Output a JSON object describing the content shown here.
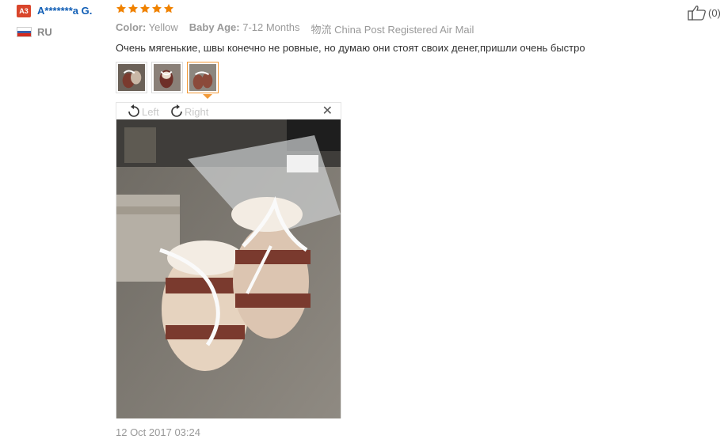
{
  "reviewer": {
    "level_badge": "A3",
    "name": "A*******a G.",
    "country": "RU"
  },
  "rating": {
    "stars": 5,
    "max": 5,
    "color": "#f08200"
  },
  "attributes": [
    {
      "label": "Color:",
      "value": "Yellow"
    },
    {
      "label": "Baby Age:",
      "value": "7-12 Months"
    },
    {
      "label": "物流",
      "value": "China Post Registered Air Mail"
    }
  ],
  "review": {
    "text": "Очень мягенькие, швы конечно не ровные, но думаю они стоят своих денег,пришли очень быстро"
  },
  "photos": {
    "count": 3,
    "active_index": 2
  },
  "viewer": {
    "rotate_left": "Left",
    "rotate_right": "Right",
    "close": "✕"
  },
  "date": "12 Oct 2017 03:24",
  "helpful": {
    "count": "(0)"
  }
}
